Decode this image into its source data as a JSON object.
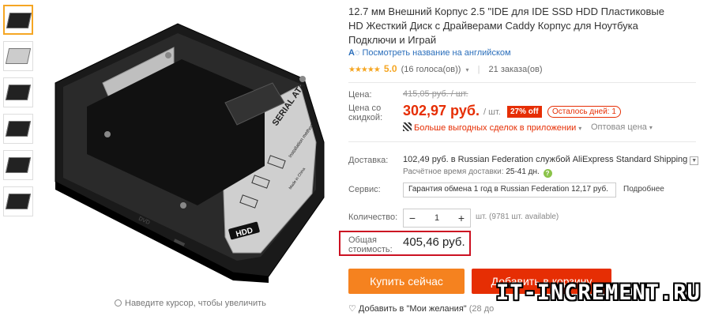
{
  "thumbnails": [
    "thumb-1",
    "thumb-2",
    "thumb-3",
    "thumb-4",
    "thumb-5",
    "thumb-6"
  ],
  "image": {
    "zoom_hint": "Наведите курсор, чтобы увеличить",
    "labels": {
      "serial_ata": "SERIAL ATA",
      "installation": "Installation method",
      "hdd": "HDD",
      "made_in_china": "Made in China",
      "dvd": "DVD"
    }
  },
  "product": {
    "title": "12.7 мм Внешний Корпус 2.5 \"IDE для IDE SSD HDD Пластиковые HD Жесткий Диск с Драйверами Caddy Корпус для Ноутбука Подключи и Играй",
    "translate_link": "Посмотреть название на английском",
    "stars": "★★★★★",
    "rating": "5.0",
    "votes": "(16 голоса(ов))",
    "orders": "21 заказа(ов)"
  },
  "price": {
    "label": "Цена:",
    "old": "415,05 руб. / шт.",
    "discount_label_1": "Цена со",
    "discount_label_2": "скидкой:",
    "current": "302,97 руб.",
    "per_unit": "/ шт.",
    "discount_badge": "27% off",
    "days_left": "Осталось дней: 1",
    "app_deals": "Больше выгодных сделок в приложении",
    "wholesale": "Оптовая цена"
  },
  "delivery": {
    "label": "Доставка:",
    "text": "102,49 руб. в Russian Federation службой AliExpress Standard Shipping",
    "eta_label": "Расчётное время доставки:",
    "eta_value": "25-41 дн."
  },
  "service": {
    "label": "Сервис:",
    "value": "Гарантия обмена 1 год в Russian Federation 12,17 руб.",
    "more": "Подробнее"
  },
  "quantity": {
    "label": "Количество:",
    "value": "1",
    "minus": "−",
    "plus": "+",
    "available": "шт. (9781 шт. available)"
  },
  "total": {
    "label_1": "Общая",
    "label_2": "стоимость:",
    "value": "405,46 руб."
  },
  "actions": {
    "buy": "Купить сейчас",
    "cart": "Добавить в корзину",
    "wishlist": "Добавить в \"Мои желания\"",
    "wishlist_count": "(28 до"
  },
  "watermark": "IT-INCREMENT.RU",
  "colors": {
    "price_red": "#e62e04",
    "buy_orange": "#f5821f",
    "highlight_border": "#cc1122",
    "star": "#f5a623"
  }
}
